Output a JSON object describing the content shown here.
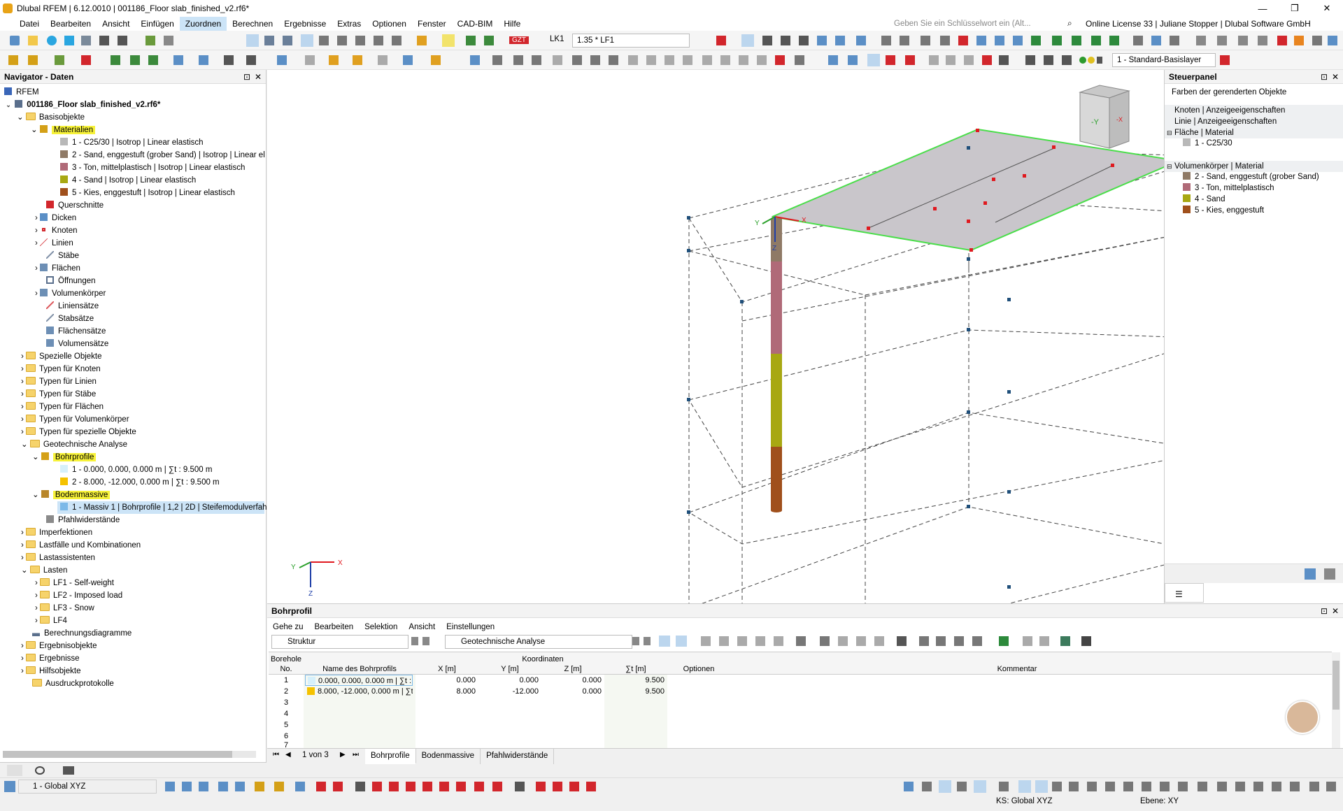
{
  "titlebar": {
    "title": "Dlubal RFEM | 6.12.0010 | 001186_Floor slab_finished_v2.rf6*",
    "minimize": "—",
    "maximize": "❐",
    "close": "✕"
  },
  "menu": [
    "Datei",
    "Bearbeiten",
    "Ansicht",
    "Einfügen",
    "Zuordnen",
    "Berechnen",
    "Ergebnisse",
    "Extras",
    "Optionen",
    "Fenster",
    "CAD-BIM",
    "Hilfe"
  ],
  "search_placeholder": "Geben Sie ein Schlüsselwort ein (Alt...",
  "license": "Online License 33 | Juliane Stopper | Dlubal Software GmbH",
  "toolbar": {
    "load_badge": "GZT",
    "load_case": "LK1",
    "combo": "1.35 * LF1",
    "layer": "1 - Standard-Basislayer"
  },
  "navigator": {
    "title": "Navigator - Daten",
    "root": "RFEM",
    "file": "001186_Floor slab_finished_v2.rf6*",
    "items": [
      {
        "label": "Basisobjekte"
      },
      {
        "label": "Materialien"
      },
      {
        "label": "1 - C25/30 | Isotrop | Linear elastisch"
      },
      {
        "label": "2 - Sand, enggestuft (grober Sand) | Isotrop | Linear el"
      },
      {
        "label": "3 - Ton, mittelplastisch | Isotrop | Linear elastisch"
      },
      {
        "label": "4 - Sand | Isotrop | Linear elastisch"
      },
      {
        "label": "5 - Kies, enggestuft | Isotrop | Linear elastisch"
      },
      {
        "label": "Querschnitte"
      },
      {
        "label": "Dicken"
      },
      {
        "label": "Knoten"
      },
      {
        "label": "Linien"
      },
      {
        "label": "Stäbe"
      },
      {
        "label": "Flächen"
      },
      {
        "label": "Öffnungen"
      },
      {
        "label": "Volumenkörper"
      },
      {
        "label": "Liniensätze"
      },
      {
        "label": "Stabsätze"
      },
      {
        "label": "Flächensätze"
      },
      {
        "label": "Volumensätze"
      },
      {
        "label": "Spezielle Objekte"
      },
      {
        "label": "Typen für Knoten"
      },
      {
        "label": "Typen für Linien"
      },
      {
        "label": "Typen für Stäbe"
      },
      {
        "label": "Typen für Flächen"
      },
      {
        "label": "Typen für Volumenkörper"
      },
      {
        "label": "Typen für spezielle Objekte"
      },
      {
        "label": "Geotechnische Analyse"
      },
      {
        "label": "Bohrprofile"
      },
      {
        "label": "1 - 0.000, 0.000, 0.000 m | ∑t : 9.500 m"
      },
      {
        "label": "2 - 8.000, -12.000, 0.000 m | ∑t : 9.500 m"
      },
      {
        "label": "Bodenmassive"
      },
      {
        "label": "1 - Massiv 1 | Bohrprofile | 1,2 | 2D | Steifemodulverfah"
      },
      {
        "label": "Pfahlwiderstände"
      },
      {
        "label": "Imperfektionen"
      },
      {
        "label": "Lastfälle und Kombinationen"
      },
      {
        "label": "Lastassistenten"
      },
      {
        "label": "Lasten"
      },
      {
        "label": "LF1 - Self-weight"
      },
      {
        "label": "LF2 - Imposed load"
      },
      {
        "label": "LF3 - Snow"
      },
      {
        "label": "LF4"
      },
      {
        "label": "Berechnungsdiagramme"
      },
      {
        "label": "Ergebnisobjekte"
      },
      {
        "label": "Ergebnisse"
      },
      {
        "label": "Hilfsobjekte"
      },
      {
        "label": "Ausdruckprotokolle"
      }
    ]
  },
  "viewport": {
    "axis_x": "X",
    "axis_y": "Y",
    "axis_z": "Z",
    "cube_y": "-Y",
    "cube_x": "-X"
  },
  "steuerpanel": {
    "title": "Steuerpanel",
    "subtitle": "Farben der gerenderten Objekte",
    "g1": "Knoten | Anzeigeeigenschaften",
    "g2": "Linie | Anzeigeeigenschaften",
    "g3": "Fläche | Material",
    "g3_item": "1 - C25/30",
    "g4": "Volumenkörper | Material",
    "g4_items": [
      "2 - Sand, enggestuft (grober Sand)",
      "3 - Ton, mittelplastisch",
      "4 - Sand",
      "5 - Kies, enggestuft"
    ]
  },
  "bottom": {
    "title": "Bohrprofil",
    "menu": [
      "Gehe zu",
      "Bearbeiten",
      "Selektion",
      "Ansicht",
      "Einstellungen"
    ],
    "drop1": "Struktur",
    "drop2": "Geotechnische Analyse",
    "headers": {
      "no1": "Borehole",
      "no2": "No.",
      "name": "Name des Bohrprofils",
      "koord": "Koordinaten",
      "x": "X [m]",
      "y": "Y [m]",
      "z": "Z [m]",
      "t": "∑t [m]",
      "opt": "Optionen",
      "kom": "Kommentar"
    },
    "rows": [
      {
        "no": "1",
        "name": "0.000, 0.000, 0.000 m | ∑t : 9.500 m",
        "x": "0.000",
        "y": "0.000",
        "z": "0.000",
        "t": "9.500"
      },
      {
        "no": "2",
        "name": "8.000, -12.000, 0.000 m | ∑t : 9.50...",
        "x": "8.000",
        "y": "-12.000",
        "z": "0.000",
        "t": "9.500"
      },
      {
        "no": "3"
      },
      {
        "no": "4"
      },
      {
        "no": "5"
      },
      {
        "no": "6"
      },
      {
        "no": "7"
      }
    ],
    "pager": "1 von 3",
    "tabs": [
      "Bohrprofile",
      "Bodenmassive",
      "Pfahlwiderstände"
    ]
  },
  "status": {
    "cs": "1 - Global XYZ",
    "ks": "KS: Global XYZ",
    "ebene": "Ebene: XY"
  }
}
